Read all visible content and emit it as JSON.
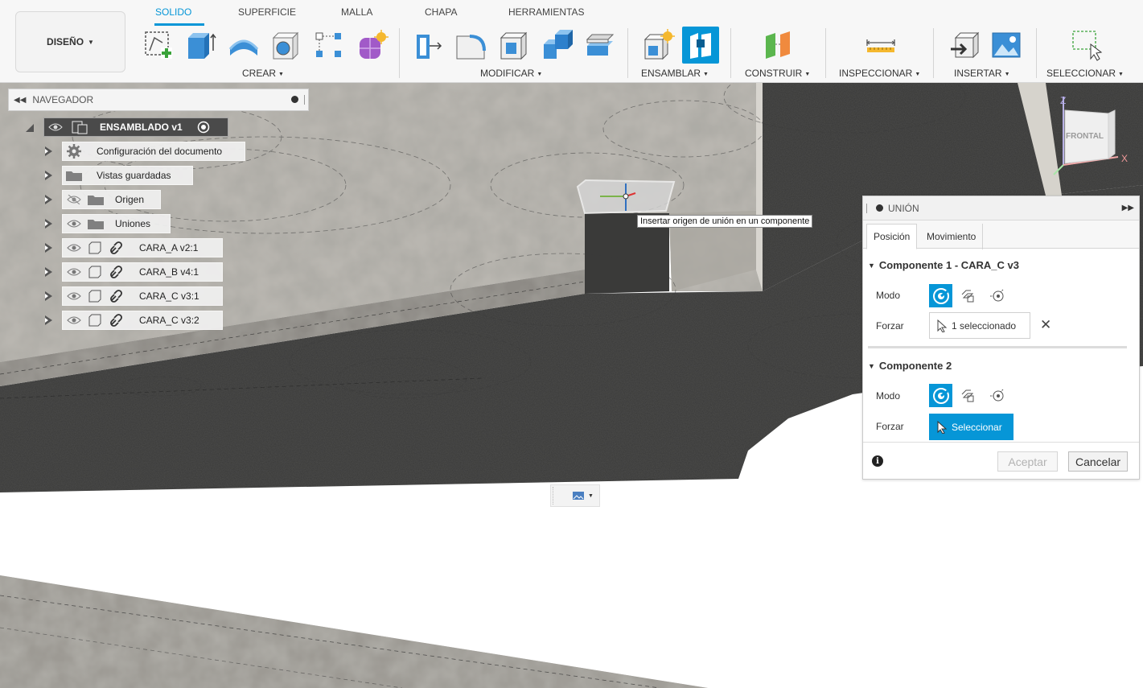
{
  "toolbar": {
    "workspace_button": "DISEÑO",
    "tabs": [
      "SOLIDO",
      "SUPERFICIE",
      "MALLA",
      "CHAPA",
      "HERRAMIENTAS"
    ],
    "groups": [
      "CREAR",
      "MODIFICAR",
      "ENSAMBLAR",
      "CONSTRUIR",
      "INSPECCIONAR",
      "INSERTAR",
      "SELECCIONAR"
    ],
    "accent": "#0696d7"
  },
  "navigator": {
    "title": "NAVEGADOR",
    "root": "ENSAMBLADO v1",
    "items": [
      {
        "label": "Configuración del documento",
        "icon": "gear-icon"
      },
      {
        "label": "Vistas guardadas",
        "icon": "folder-icon"
      },
      {
        "label": "Origen",
        "icon": "folder-icon"
      },
      {
        "label": "Uniones",
        "icon": "folder-icon"
      },
      {
        "label": "CARA_A v2:1",
        "icon": "component-icon"
      },
      {
        "label": "CARA_B v4:1",
        "icon": "component-icon"
      },
      {
        "label": "CARA_C v3:1",
        "icon": "component-icon"
      },
      {
        "label": "CARA_C v3:2",
        "icon": "component-icon"
      }
    ]
  },
  "viewport": {
    "tooltip": "Insertar origen de unión en un componente",
    "viewcube_face": "FRONTAL",
    "axis_z": "Z",
    "axis_x": "X"
  },
  "joint_dialog": {
    "title": "UNIÓN",
    "tabs": [
      "Posición",
      "Movimiento"
    ],
    "component1": {
      "heading": "Componente 1 - CARA_C v3",
      "mode_label": "Modo",
      "snap_label": "Forzar",
      "snap_value": "1 seleccionado"
    },
    "component2": {
      "heading": "Componente 2",
      "mode_label": "Modo",
      "snap_label": "Forzar",
      "snap_value": "Seleccionar"
    },
    "ok_label": "Aceptar",
    "cancel_label": "Cancelar"
  }
}
